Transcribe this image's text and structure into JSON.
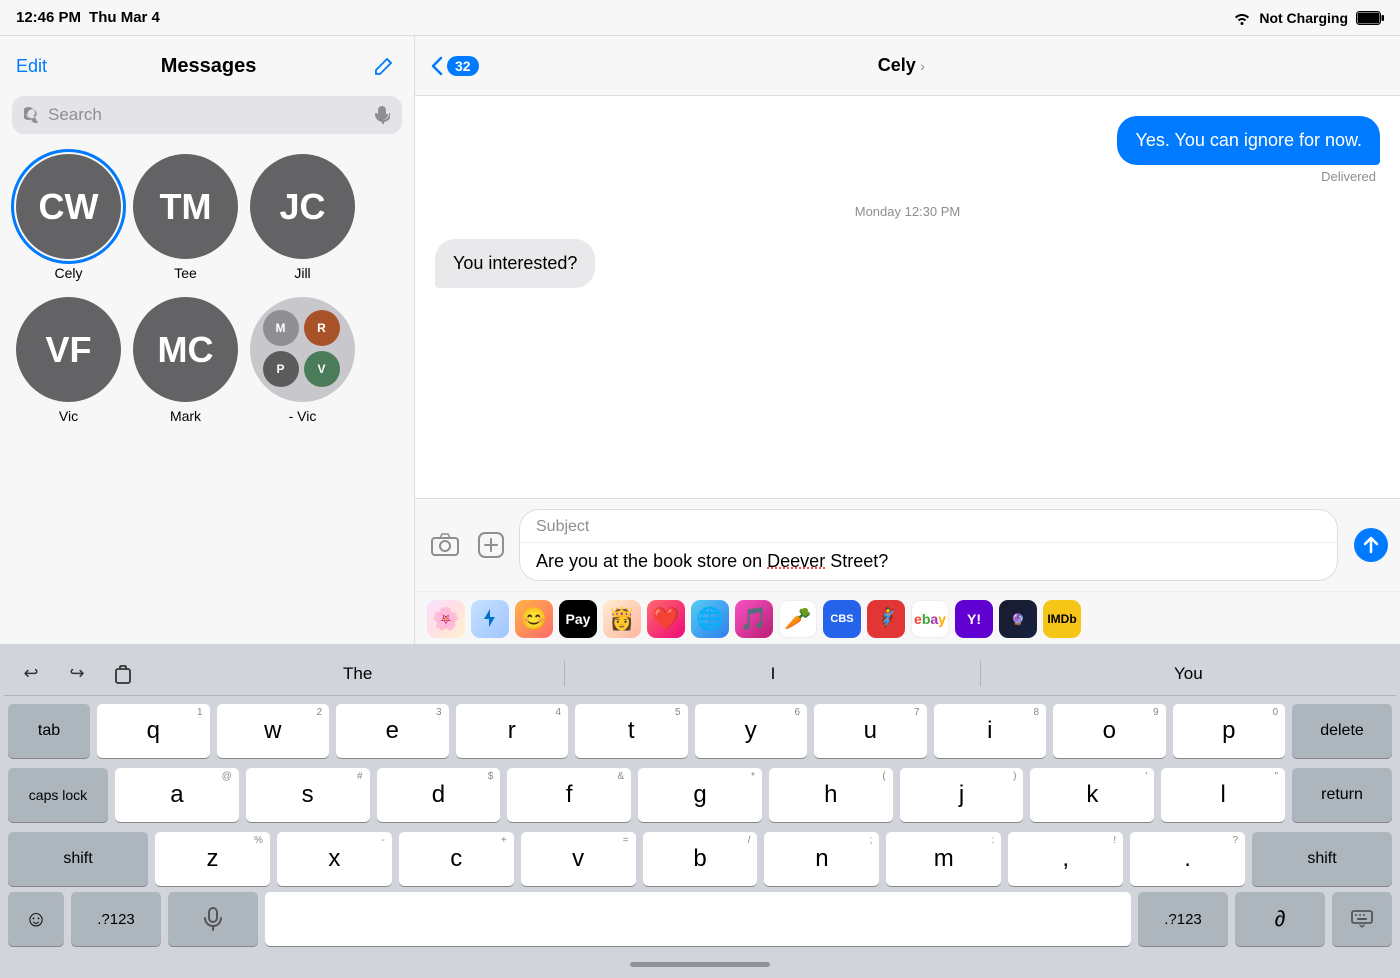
{
  "statusBar": {
    "time": "12:46 PM",
    "date": "Thu Mar 4",
    "wifi": "wifi",
    "battery": "Not Charging"
  },
  "leftPanel": {
    "editLabel": "Edit",
    "title": "Messages",
    "searchPlaceholder": "Search",
    "pinnedRow1": [
      {
        "initials": "CW",
        "name": "Cely",
        "selected": true
      },
      {
        "initials": "TM",
        "name": "Tee",
        "selected": false
      },
      {
        "initials": "JC",
        "name": "Jill",
        "selected": false
      }
    ],
    "pinnedRow2": [
      {
        "initials": "VF",
        "name": "Vic",
        "selected": false
      },
      {
        "initials": "MC",
        "name": "Mark",
        "selected": false
      },
      {
        "initials": "multi",
        "name": "- Vic",
        "selected": false
      }
    ]
  },
  "rightPanel": {
    "backCount": "32",
    "contactName": "Cely",
    "messages": [
      {
        "type": "sent",
        "text": "Yes. You can ignore for now.",
        "status": "Delivered"
      },
      {
        "type": "timestamp",
        "text": "Monday 12:30 PM"
      },
      {
        "type": "received",
        "text": "You interested?"
      }
    ],
    "subjectPlaceholder": "Subject",
    "messageText": "Are you at the book store on Deever Street?",
    "underlineWord": "Deever"
  },
  "keyboard": {
    "suggestions": [
      "The",
      "I",
      "You"
    ],
    "undoLabel": "↩",
    "redoLabel": "↪",
    "rows": [
      [
        "q",
        "w",
        "e",
        "r",
        "t",
        "y",
        "u",
        "i",
        "o",
        "p"
      ],
      [
        "a",
        "s",
        "d",
        "f",
        "g",
        "h",
        "j",
        "k",
        "l"
      ],
      [
        "z",
        "x",
        "c",
        "v",
        "b",
        "n",
        "m"
      ]
    ],
    "nums": [
      [
        "1",
        "2",
        "3",
        "4",
        "5",
        "6",
        "7",
        "8",
        "9",
        "0"
      ],
      [
        "@",
        "#",
        "$",
        "&",
        "*",
        "(",
        ")",
        "\\'",
        "\""
      ],
      [
        "%",
        "-",
        "+",
        "=",
        "/",
        ";",
        ":",
        "!",
        "?"
      ]
    ],
    "tabLabel": "tab",
    "deleteLabel": "delete",
    "capsLockLabel": "caps lock",
    "returnLabel": "return",
    "shiftLabel": "shift",
    "emojiLabel": "☺",
    "numbersLabel": ".?123",
    "micLabel": "🎤",
    "numbersRightLabel": ".?123",
    "scribbleLabel": "∂",
    "keyboardLabel": "⌨"
  },
  "appStrip": [
    {
      "label": "🌸",
      "name": "photos-app"
    },
    {
      "label": "🅐",
      "name": "appstore-app"
    },
    {
      "label": "😀",
      "name": "memoji-app"
    },
    {
      "label": "💳",
      "name": "applepay-app"
    },
    {
      "label": "👸",
      "name": "memoji2-app"
    },
    {
      "label": "❤️",
      "name": "heart-app"
    },
    {
      "label": "🌐",
      "name": "browser-app"
    },
    {
      "label": "🎵",
      "name": "music-app"
    },
    {
      "label": "🥕",
      "name": "instacart-app"
    },
    {
      "label": "📺",
      "name": "cbs-app"
    },
    {
      "label": "🦸",
      "name": "marvel-app"
    },
    {
      "label": "🛒",
      "name": "ebay-app"
    },
    {
      "label": "Y!",
      "name": "yahoo-app"
    },
    {
      "label": "🔮",
      "name": "darksky-app"
    },
    {
      "label": "🎬",
      "name": "imdb-app"
    }
  ]
}
